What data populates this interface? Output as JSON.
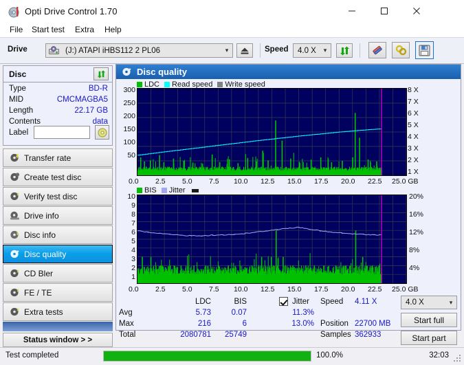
{
  "window": {
    "title": "Opti Drive Control 1.70",
    "icon": "disc-icon",
    "minimize": "—",
    "maximize": "□",
    "close": "✕"
  },
  "menu": [
    {
      "label": "File"
    },
    {
      "label": "Start test"
    },
    {
      "label": "Extra"
    },
    {
      "label": "Help"
    }
  ],
  "toolbar": {
    "drive_label": "Drive",
    "drive_value": "(J:)  ATAPI iHBS112  2 PL06",
    "drive_icon": "drive-icon",
    "eject_icon": "eject-icon",
    "speed_label": "Speed",
    "speed_value": "4.0 X",
    "refresh_icon": "refresh-icon",
    "erase_icon": "eraser-icon",
    "link_icon": "link-icon",
    "save_icon": "save-icon"
  },
  "disc": {
    "header": "Disc",
    "refresh_icon": "refresh-icon",
    "rows": [
      {
        "key": "Type",
        "value": "BD-R"
      },
      {
        "key": "MID",
        "value": "CMCMAGBA5"
      },
      {
        "key": "Length",
        "value": "22.17 GB"
      },
      {
        "key": "Contents",
        "value": "data"
      }
    ],
    "label_key": "Label",
    "label_value": "",
    "label_placeholder": "",
    "disc_icon": "cd-icon"
  },
  "nav": {
    "items": [
      {
        "label": "Transfer rate",
        "icon": "disc-test-icon",
        "active": false
      },
      {
        "label": "Create test disc",
        "icon": "disc-burn-icon",
        "active": false
      },
      {
        "label": "Verify test disc",
        "icon": "disc-verify-icon",
        "active": false
      },
      {
        "label": "Drive info",
        "icon": "drive-info-icon",
        "active": false
      },
      {
        "label": "Disc info",
        "icon": "disc-info-icon",
        "active": false
      },
      {
        "label": "Disc quality",
        "icon": "disc-quality-icon",
        "active": true
      },
      {
        "label": "CD Bler",
        "icon": "cd-bler-icon",
        "active": false
      },
      {
        "label": "FE / TE",
        "icon": "fe-te-icon",
        "active": false
      },
      {
        "label": "Extra tests",
        "icon": "extra-tests-icon",
        "active": false
      }
    ],
    "status_window": "Status window > >"
  },
  "panel": {
    "title": "Disc quality",
    "icon": "disc-quality-icon"
  },
  "stats": {
    "col_ldc": "LDC",
    "col_bis": "BIS",
    "jitter_label": "Jitter",
    "jitter_checked": true,
    "rows": [
      {
        "name": "Avg",
        "ldc": "5.73",
        "bis": "0.07",
        "jitter": "11.3%"
      },
      {
        "name": "Max",
        "ldc": "216",
        "bis": "6",
        "jitter": "13.0%"
      },
      {
        "name": "Total",
        "ldc": "2080781",
        "bis": "25749",
        "jitter": ""
      }
    ],
    "speed_label": "Speed",
    "speed_value": "4.11 X",
    "position_label": "Position",
    "position_value": "22700 MB",
    "samples_label": "Samples",
    "samples_value": "362933",
    "speed_select": "4.0 X",
    "start_full": "Start full",
    "start_part": "Start part"
  },
  "statusbar": {
    "message": "Test completed",
    "progress_text": "100.0%",
    "progress_value": 100,
    "elapsed": "32:03"
  },
  "colors": {
    "ldc": "#00c000",
    "read_speed": "#00ffff",
    "write_speed": "#808080",
    "bis": "#00c000",
    "jitter": "#9fa8f0",
    "plot_bg": "#00005f",
    "marker": "#c000c0",
    "accent": "#1717c8"
  },
  "chart_data": [
    {
      "type": "line",
      "title": "Disc quality - LDC / speed",
      "xlabel": "GB",
      "ylabel": "LDC",
      "y2label": "X",
      "xlim": [
        0,
        25
      ],
      "ylim": [
        0,
        300
      ],
      "y2lim": [
        0,
        8
      ],
      "grid": true,
      "legend_position": "top-left",
      "xticks": [
        "0.0",
        "2.5",
        "5.0",
        "7.5",
        "10.0",
        "12.5",
        "15.0",
        "17.5",
        "20.0",
        "22.5",
        "25.0 GB"
      ],
      "yticks": [
        "300",
        "250",
        "200",
        "150",
        "100",
        "50"
      ],
      "y2ticks": [
        "8 X",
        "7 X",
        "6 X",
        "5 X",
        "4 X",
        "3 X",
        "2 X",
        "1 X"
      ],
      "legend": [
        {
          "name": "LDC",
          "color": "#00c000"
        },
        {
          "name": "Read speed",
          "color": "#00ffff"
        },
        {
          "name": "Write speed",
          "color": "#808080"
        }
      ],
      "data_end_gb": 22.7,
      "series": [
        {
          "name": "Read speed",
          "color": "#00ffff",
          "axis": "y2",
          "x": [
            0.0,
            1.0,
            2.0,
            3.0,
            4.0,
            5.0,
            6.0,
            7.0,
            8.0,
            9.0,
            10.0,
            11.0,
            12.0,
            13.0,
            14.0,
            15.0,
            16.0,
            17.0,
            18.0,
            19.0,
            20.0,
            21.0,
            22.0,
            22.7
          ],
          "values": [
            1.82,
            1.95,
            2.08,
            2.2,
            2.32,
            2.44,
            2.56,
            2.68,
            2.8,
            2.92,
            3.04,
            3.16,
            3.27,
            3.38,
            3.49,
            3.6,
            3.7,
            3.8,
            3.9,
            4.0,
            4.08,
            4.16,
            4.24,
            4.28
          ]
        },
        {
          "name": "LDC",
          "color": "#00c000",
          "axis": "y1",
          "note": "dense per-sample bars, baseline ~10-25, frequent spikes 40-90, major spikes near 12.8 GB (190) and 20.2 GB (216)",
          "baseline": 16,
          "spikes": [
            {
              "x": 0.25,
              "y": 62
            },
            {
              "x": 0.6,
              "y": 48
            },
            {
              "x": 1.15,
              "y": 52
            },
            {
              "x": 2.0,
              "y": 70
            },
            {
              "x": 2.4,
              "y": 45
            },
            {
              "x": 3.3,
              "y": 58
            },
            {
              "x": 4.25,
              "y": 50
            },
            {
              "x": 5.1,
              "y": 44
            },
            {
              "x": 6.0,
              "y": 40
            },
            {
              "x": 6.9,
              "y": 72
            },
            {
              "x": 7.6,
              "y": 46
            },
            {
              "x": 8.5,
              "y": 55
            },
            {
              "x": 9.3,
              "y": 42
            },
            {
              "x": 10.2,
              "y": 60
            },
            {
              "x": 11.0,
              "y": 48
            },
            {
              "x": 11.6,
              "y": 85
            },
            {
              "x": 12.1,
              "y": 52
            },
            {
              "x": 12.8,
              "y": 190
            },
            {
              "x": 13.4,
              "y": 120
            },
            {
              "x": 14.2,
              "y": 58
            },
            {
              "x": 15.0,
              "y": 47
            },
            {
              "x": 16.1,
              "y": 54
            },
            {
              "x": 17.0,
              "y": 62
            },
            {
              "x": 18.0,
              "y": 45
            },
            {
              "x": 19.0,
              "y": 50
            },
            {
              "x": 20.2,
              "y": 216
            },
            {
              "x": 20.6,
              "y": 130
            },
            {
              "x": 21.4,
              "y": 55
            },
            {
              "x": 22.2,
              "y": 48
            }
          ]
        }
      ]
    },
    {
      "type": "line",
      "title": "Disc quality - BIS / jitter",
      "xlabel": "GB",
      "ylabel": "BIS",
      "y2label": "%",
      "xlim": [
        0,
        25
      ],
      "ylim": [
        0,
        10
      ],
      "y2lim": [
        0,
        20
      ],
      "grid": true,
      "legend_position": "top-left",
      "xticks": [
        "0.0",
        "2.5",
        "5.0",
        "7.5",
        "10.0",
        "12.5",
        "15.0",
        "17.5",
        "20.0",
        "22.5",
        "25.0 GB"
      ],
      "yticks": [
        "10",
        "9",
        "8",
        "7",
        "6",
        "5",
        "4",
        "3",
        "2",
        "1"
      ],
      "y2ticks": [
        "20%",
        "16%",
        "12%",
        "8%",
        "4%"
      ],
      "legend": [
        {
          "name": "BIS",
          "color": "#00c000"
        },
        {
          "name": "Jitter",
          "color": "#9fa8f0"
        }
      ],
      "data_end_gb": 22.7,
      "series": [
        {
          "name": "Jitter",
          "color": "#9fa8f0",
          "axis": "y2",
          "x": [
            0.0,
            1.0,
            2.0,
            3.0,
            4.0,
            5.0,
            6.0,
            7.0,
            8.0,
            9.0,
            10.0,
            11.0,
            12.0,
            13.0,
            14.0,
            15.0,
            16.0,
            17.0,
            18.0,
            19.0,
            20.0,
            21.0,
            22.0,
            22.7
          ],
          "values": [
            11.9,
            11.6,
            11.3,
            11.1,
            10.9,
            10.8,
            10.8,
            10.9,
            11.0,
            11.1,
            11.3,
            11.6,
            11.9,
            12.2,
            12.5,
            12.7,
            12.3,
            11.9,
            11.6,
            11.4,
            11.2,
            11.1,
            11.0,
            11.0
          ]
        },
        {
          "name": "BIS",
          "color": "#00c000",
          "axis": "y1",
          "note": "dense per-sample bars, baseline ~1, frequent ticks to 2, occasional 3, two spikes to 6",
          "baseline": 1,
          "spikes": [
            {
              "x": 0.4,
              "y": 3
            },
            {
              "x": 1.2,
              "y": 3
            },
            {
              "x": 2.1,
              "y": 2
            },
            {
              "x": 3.0,
              "y": 2
            },
            {
              "x": 4.0,
              "y": 2
            },
            {
              "x": 5.2,
              "y": 2
            },
            {
              "x": 6.3,
              "y": 2
            },
            {
              "x": 7.5,
              "y": 2
            },
            {
              "x": 8.4,
              "y": 2
            },
            {
              "x": 9.5,
              "y": 2
            },
            {
              "x": 10.6,
              "y": 2
            },
            {
              "x": 11.5,
              "y": 3
            },
            {
              "x": 12.4,
              "y": 3
            },
            {
              "x": 12.85,
              "y": 6
            },
            {
              "x": 13.5,
              "y": 3
            },
            {
              "x": 14.4,
              "y": 2
            },
            {
              "x": 15.6,
              "y": 2
            },
            {
              "x": 16.4,
              "y": 2
            },
            {
              "x": 17.3,
              "y": 2
            },
            {
              "x": 18.4,
              "y": 2
            },
            {
              "x": 19.3,
              "y": 2
            },
            {
              "x": 20.25,
              "y": 6
            },
            {
              "x": 20.9,
              "y": 3
            },
            {
              "x": 21.8,
              "y": 2
            },
            {
              "x": 22.4,
              "y": 2
            }
          ]
        }
      ]
    }
  ]
}
